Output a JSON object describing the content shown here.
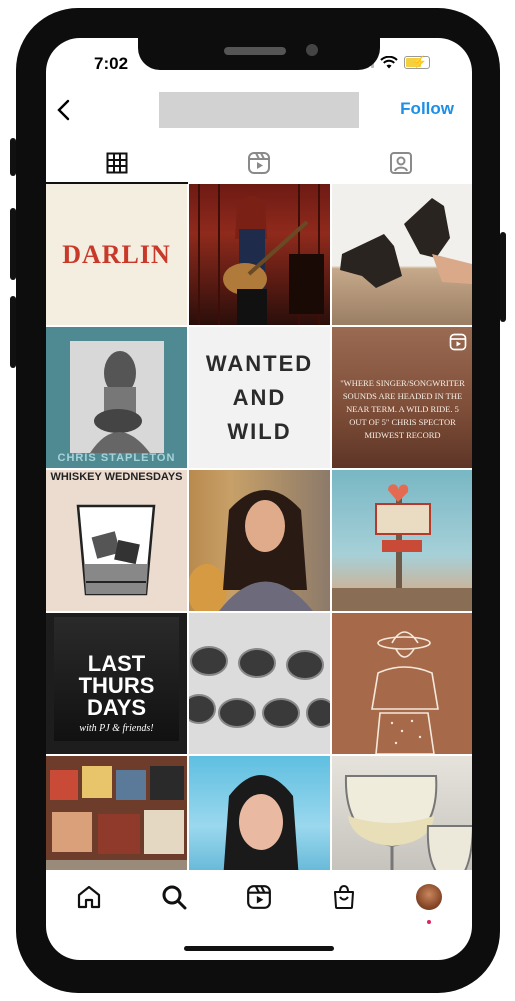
{
  "status_bar": {
    "time": "7:02"
  },
  "header": {
    "follow_label": "Follow"
  },
  "tabs": [
    {
      "icon": "grid-icon",
      "active": true
    },
    {
      "icon": "reels-icon",
      "active": false
    },
    {
      "icon": "tagged-icon",
      "active": false
    }
  ],
  "posts": [
    {
      "text": "DARLIN",
      "icon": ""
    },
    {
      "text": "",
      "icon": ""
    },
    {
      "text": "",
      "icon": ""
    },
    {
      "text": "CHRIS STAPLETON",
      "icon": ""
    },
    {
      "text": "WANTED AND WILD",
      "icon": ""
    },
    {
      "text": "\"WHERE SINGER/SONGWRITER SOUNDS ARE HEADED IN THE NEAR TERM. A WILD RIDE. 5 OUT OF 5\" CHRIS SPECTOR MIDWEST RECORD",
      "icon": "reels-icon"
    },
    {
      "text": "WHISKEY WEDNESDAYS",
      "icon": ""
    },
    {
      "text": "",
      "icon": ""
    },
    {
      "text": "",
      "icon": ""
    },
    {
      "text": "LAST THURS DAYS",
      "sub": "with PJ & friends!",
      "icon": ""
    },
    {
      "text": "",
      "icon": ""
    },
    {
      "text": "",
      "icon": ""
    },
    {
      "text": "",
      "icon": ""
    },
    {
      "text": "",
      "icon": ""
    },
    {
      "text": "",
      "icon": ""
    }
  ],
  "bottom_nav": [
    {
      "icon": "home-icon"
    },
    {
      "icon": "search-icon"
    },
    {
      "icon": "reels-icon"
    },
    {
      "icon": "shop-icon"
    },
    {
      "icon": "profile-avatar"
    }
  ],
  "colors": {
    "accent": "#1d8fe6",
    "notification": "#e0245e"
  }
}
